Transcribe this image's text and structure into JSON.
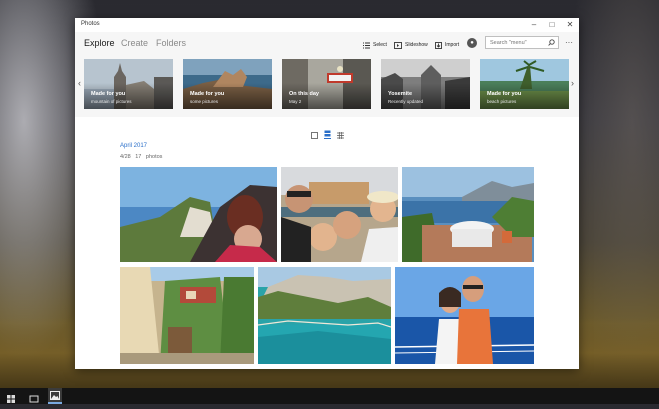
{
  "window": {
    "title": "Photos"
  },
  "nav": {
    "explore": "Explore",
    "create": "Create",
    "folders": "Folders"
  },
  "commands": {
    "select": "Select",
    "slideshow": "Slideshow",
    "import": "Import"
  },
  "search": {
    "placeholder": "Search \"menu\""
  },
  "carousel": [
    {
      "title": "Made for you",
      "subtitle": "mountain of pictures"
    },
    {
      "title": "Made for you",
      "subtitle": "some pictures"
    },
    {
      "title": "On this day",
      "subtitle": "May 2"
    },
    {
      "title": "Yosemite",
      "subtitle": "Recently updated"
    },
    {
      "title": "Made for you",
      "subtitle": "beach pictures"
    }
  ],
  "collection": {
    "month": "April 2017",
    "date": "4/28",
    "count": "17 photos"
  },
  "colors": {
    "accent": "#2a6fc9",
    "window_bg": "#ffffff",
    "taskbar": "#141414"
  }
}
